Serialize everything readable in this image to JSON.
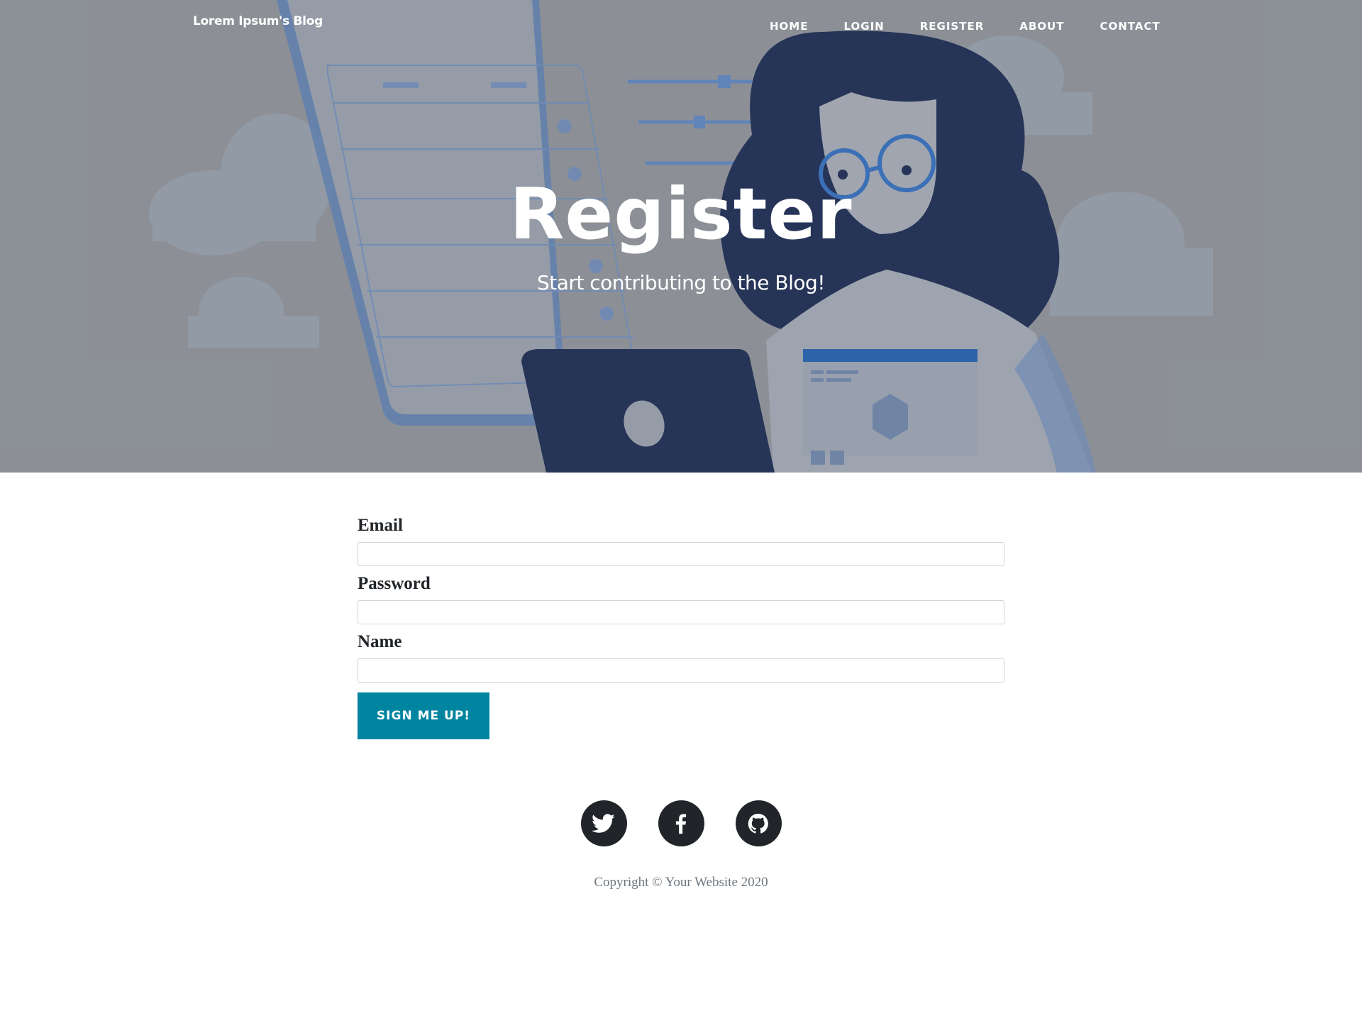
{
  "navbar": {
    "brand": "Lorem Ipsum's Blog",
    "items": [
      {
        "label": "HOME"
      },
      {
        "label": "LOGIN"
      },
      {
        "label": "REGISTER"
      },
      {
        "label": "ABOUT"
      },
      {
        "label": "CONTACT"
      }
    ]
  },
  "hero": {
    "title": "Register",
    "subtitle": "Start contributing to the Blog!"
  },
  "form": {
    "email_label": "Email",
    "email_value": "",
    "password_label": "Password",
    "password_value": "",
    "name_label": "Name",
    "name_value": "",
    "submit_label": "SIGN ME UP!"
  },
  "footer": {
    "social": [
      {
        "icon": "twitter-icon"
      },
      {
        "icon": "facebook-icon"
      },
      {
        "icon": "github-icon"
      }
    ],
    "copyright": "Copyright © Your Website 2020"
  },
  "colors": {
    "primary": "#0085a1",
    "dark": "#212529",
    "hero_overlay": "#8f9399",
    "illustration_navy": "#13234d",
    "illustration_blue": "#5b84c4"
  }
}
